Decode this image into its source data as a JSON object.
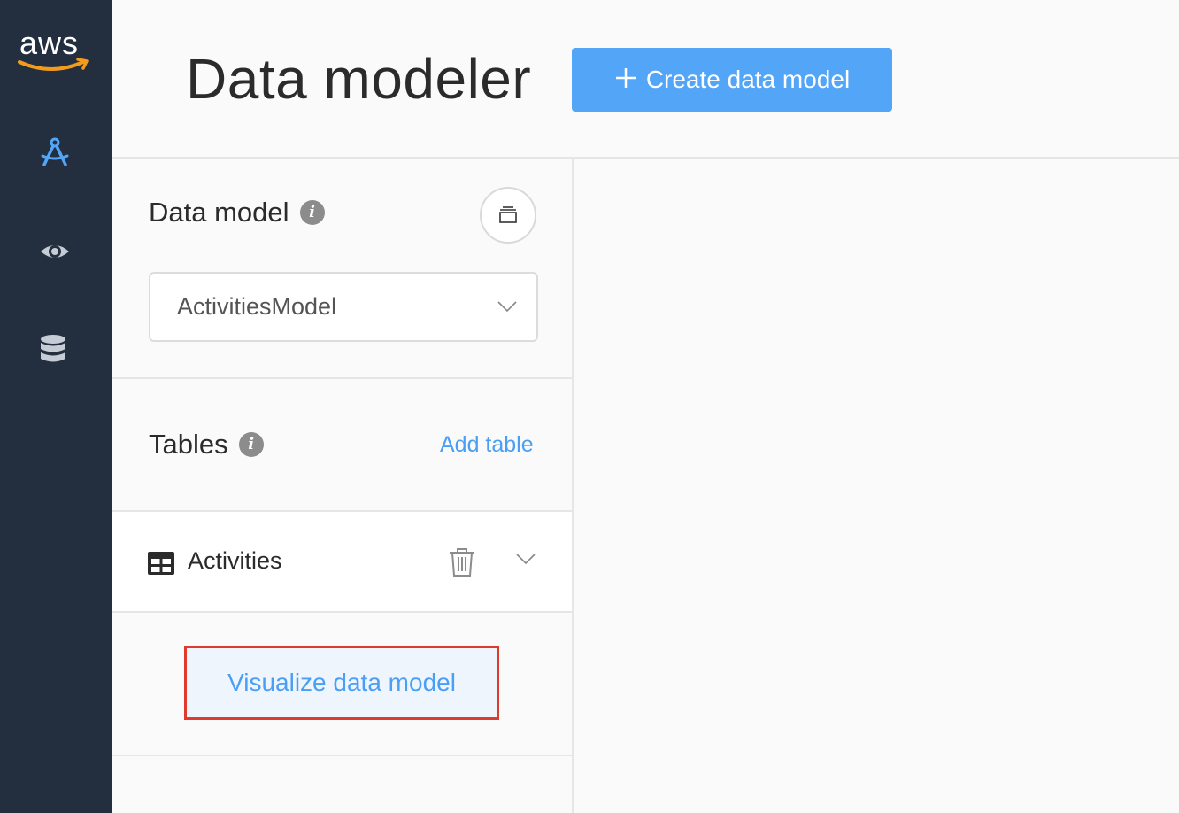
{
  "rail": {
    "logo_text": "aws",
    "items": [
      {
        "icon": "data-modeler-icon",
        "active": true
      },
      {
        "icon": "visualizer-eye-icon",
        "active": false
      },
      {
        "icon": "database-icon",
        "active": false
      }
    ],
    "colors": {
      "background": "#232f3e",
      "active": "#52a5f7",
      "inactive": "#c5ccd6",
      "smile": "#f29b1d"
    }
  },
  "header": {
    "title": "Data modeler",
    "create_button_label": "Create data model"
  },
  "data_model_section": {
    "title": "Data model",
    "selected_model": "ActivitiesModel"
  },
  "tables_section": {
    "title": "Tables",
    "add_table_label": "Add table",
    "tables": [
      {
        "name": "Activities"
      }
    ]
  },
  "visualize_button_label": "Visualize data model",
  "colors": {
    "primary": "#52a5f7",
    "link": "#4a9ff5",
    "highlight_border": "#e03a2e"
  }
}
